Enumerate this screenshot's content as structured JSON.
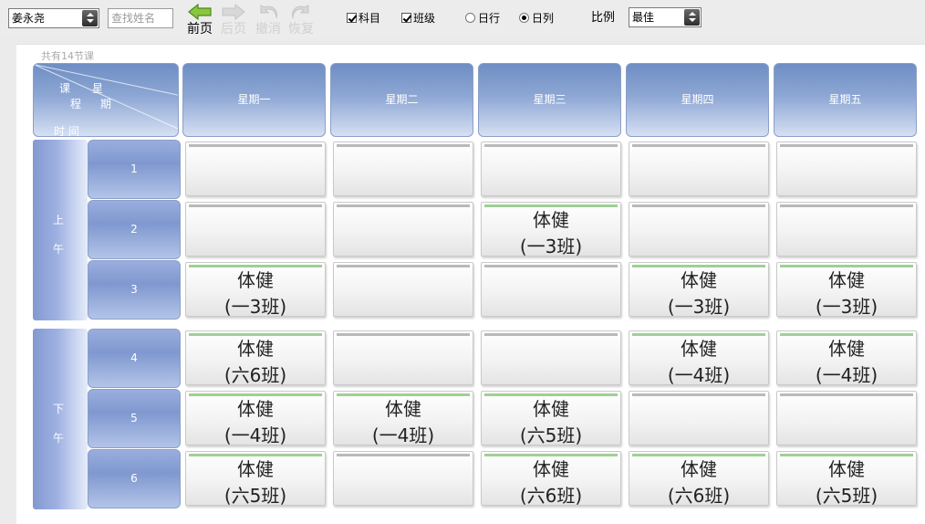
{
  "toolbar": {
    "teacher_select": "姜永尧",
    "search_placeholder": "查找姓名",
    "nav": [
      {
        "label": "前页",
        "icon": "arrow-left-icon",
        "enabled": true
      },
      {
        "label": "后页",
        "icon": "arrow-right-icon",
        "enabled": false
      },
      {
        "label": "撤消",
        "icon": "undo-icon",
        "enabled": false
      },
      {
        "label": "恢复",
        "icon": "redo-icon",
        "enabled": false
      }
    ],
    "checkboxes": [
      {
        "label": "科目",
        "checked": true
      },
      {
        "label": "班级",
        "checked": true
      }
    ],
    "radios": [
      {
        "label": "日行",
        "checked": false
      },
      {
        "label": "日列",
        "checked": true
      }
    ],
    "ratio_label": "比例",
    "ratio_select": "最佳"
  },
  "timetable": {
    "lesson_count": "共有14节课",
    "corner": {
      "a": "课",
      "b": "星",
      "c": "程",
      "d": "期",
      "e": "时 间"
    },
    "days": [
      "星期一",
      "星期二",
      "星期三",
      "星期四",
      "星期五"
    ],
    "sections": [
      {
        "name": [
          "上",
          "午"
        ],
        "periods": [
          "1",
          "2",
          "3"
        ]
      },
      {
        "name": [
          "下",
          "午"
        ],
        "periods": [
          "4",
          "5",
          "6"
        ]
      }
    ],
    "rows": [
      [
        "",
        "",
        "",
        "",
        ""
      ],
      [
        "",
        "",
        "体健\n(一3班)",
        "",
        ""
      ],
      [
        "体健\n(一3班)",
        "",
        "",
        "体健\n(一3班)",
        "体健\n(一3班)"
      ],
      [
        "体健\n(六6班)",
        "",
        "",
        "体健\n(一4班)",
        "体健\n(一4班)"
      ],
      [
        "体健\n(一4班)",
        "体健\n(一4班)",
        "体健\n(六5班)",
        "",
        ""
      ],
      [
        "体健\n(六5班)",
        "",
        "体健\n(六6班)",
        "体健\n(六6班)",
        "体健\n(六5班)"
      ]
    ]
  },
  "colors": {
    "header_blue": "#7f98cf",
    "filled_bar": "#9ed096",
    "empty_bar": "#b9b9b9"
  }
}
